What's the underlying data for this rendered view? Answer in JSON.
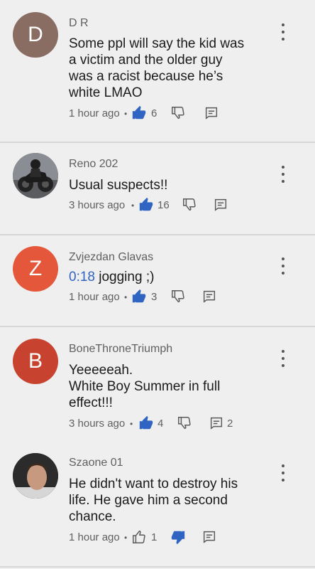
{
  "comments": [
    {
      "author": "D R",
      "avatar_letter": "D",
      "avatar_color": "#8a6d62",
      "text_lines": [
        "Some ppl will say the kid was",
        "a victim and the older guy",
        "was a racist because he’s",
        "white LMAO"
      ],
      "time": "1 hour ago",
      "likes": "6",
      "liked": true,
      "disliked": false,
      "replies": ""
    },
    {
      "author": "Reno 202",
      "avatar_image": "motorcycle-photo",
      "text_lines": [
        "Usual suspects!!"
      ],
      "time": "3 hours ago",
      "likes": "16",
      "liked": true,
      "disliked": false,
      "replies": ""
    },
    {
      "author": "Zvjezdan Glavas",
      "avatar_letter": "Z",
      "avatar_color": "#e4573a",
      "timestamp_link": "0:18",
      "text_after_link": " jogging ;)",
      "time": "1 hour ago",
      "likes": "3",
      "liked": true,
      "disliked": false,
      "replies": ""
    },
    {
      "author": "BoneThroneTriumph",
      "avatar_letter": "B",
      "avatar_color": "#c8432f",
      "text_lines": [
        "Yeeeeeah.",
        "White Boy Summer in full",
        "effect!!!"
      ],
      "time": "3 hours ago",
      "likes": "4",
      "liked": true,
      "disliked": false,
      "replies": "2"
    },
    {
      "author": "Szaone 01",
      "avatar_image": "portrait-photo",
      "text_lines": [
        "He didn't want to destroy his",
        "life. He gave him a second",
        "chance."
      ],
      "time": "1 hour ago",
      "likes": "1",
      "liked": false,
      "disliked": true,
      "replies": ""
    }
  ],
  "colors": {
    "active_icon": "#2f64c2",
    "inactive_icon": "#5a5a5a",
    "background": "#efefef"
  }
}
